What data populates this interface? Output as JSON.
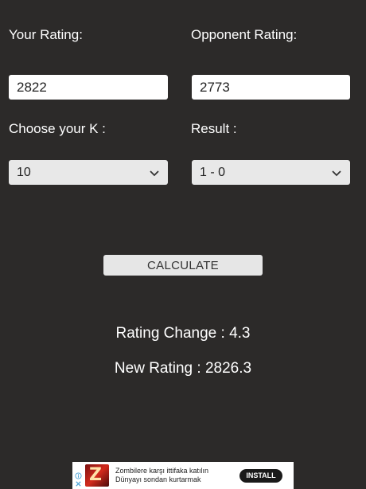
{
  "labels": {
    "your_rating": "Your Rating:",
    "opponent_rating": "Opponent Rating:",
    "choose_k": "Choose your K :",
    "result": "Result :"
  },
  "inputs": {
    "your_rating_value": "2822",
    "opponent_rating_value": "2773"
  },
  "selects": {
    "k_value": "10",
    "result_value": "1 - 0"
  },
  "buttons": {
    "calculate": "CALCULATE"
  },
  "output": {
    "rating_change": "Rating Change : 4.3",
    "new_rating": "New Rating : 2826.3"
  },
  "ad": {
    "line1": "Zombilere karşı ittifaka katılın",
    "line2": "Dünyayı sondan kurtarmak",
    "install": "INSTALL",
    "logo_letter": "Z"
  },
  "colors": {
    "background": "#2c2a29",
    "text": "#ffffff",
    "input_bg": "#ffffff",
    "select_bg": "#e8e8e8",
    "button_bg": "#e6e6e6"
  }
}
